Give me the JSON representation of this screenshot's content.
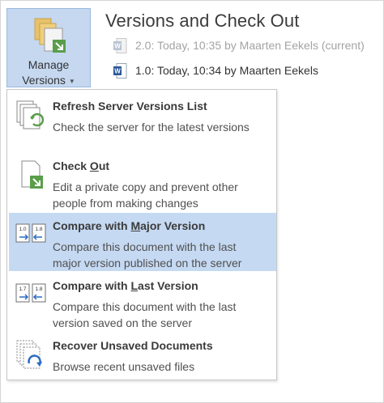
{
  "manage_button": {
    "line1": "Manage",
    "line2": "Versions"
  },
  "section": {
    "title": "Versions and Check Out"
  },
  "versions": [
    {
      "label": "2.0: Today, 10:35 by Maarten Eekels (current)",
      "app_icon": "word-doc-icon-faded"
    },
    {
      "label": "1.0: Today, 10:34 by Maarten Eekels",
      "app_icon": "word-doc-icon"
    }
  ],
  "menu": {
    "items": [
      {
        "title": "Refresh Server Versions List",
        "description": "Check the server for the latest versions",
        "icon": "refresh-versions-icon"
      },
      {
        "title_pre": "Check ",
        "title_accel": "O",
        "title_post": "ut",
        "description": "Edit a private copy and prevent other people from making changes",
        "icon": "check-out-icon"
      },
      {
        "title_pre": "Compare with ",
        "title_accel": "M",
        "title_post": "ajor Version",
        "description": "Compare this document with the last major version published on the server",
        "icon": "compare-major-icon",
        "highlighted": true
      },
      {
        "title_pre": "Compare with ",
        "title_accel": "L",
        "title_post": "ast Version",
        "description": "Compare this document with the last version saved on the server",
        "icon": "compare-last-icon"
      },
      {
        "title": "Recover Unsaved Documents",
        "description": "Browse recent unsaved files",
        "icon": "recover-unsaved-icon"
      }
    ]
  },
  "icon_labels": {
    "major_left": "1.0",
    "major_right": "1.8",
    "last_left": "1.7",
    "last_right": "1.8"
  },
  "colors": {
    "highlight": "#c5d9f2",
    "button_bg": "#c5d8f0",
    "word_blue": "#2b5797",
    "checkout_green": "#5a9e4b"
  }
}
